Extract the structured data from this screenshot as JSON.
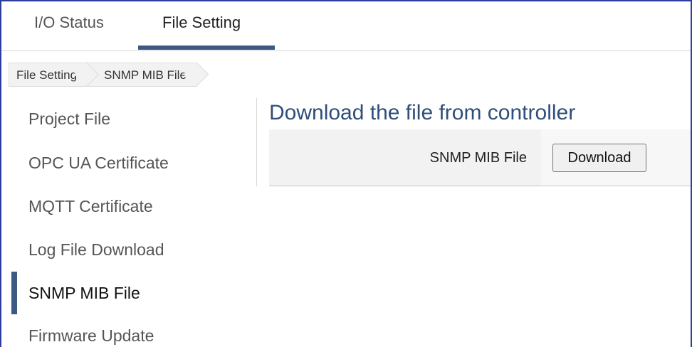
{
  "tabs": [
    {
      "label": "I/O Status",
      "active": false
    },
    {
      "label": "File Setting",
      "active": true
    }
  ],
  "breadcrumb": [
    "File Setting",
    "SNMP MIB File"
  ],
  "sidebar": {
    "items": [
      {
        "label": "Project File",
        "active": false
      },
      {
        "label": "OPC UA Certificate",
        "active": false
      },
      {
        "label": "MQTT Certificate",
        "active": false
      },
      {
        "label": "Log File Download",
        "active": false
      },
      {
        "label": "SNMP MIB File",
        "active": true
      },
      {
        "label": "Firmware Update",
        "active": false
      }
    ]
  },
  "main": {
    "title": "Download the file from controller",
    "row_label": "SNMP MIB File",
    "download_label": "Download"
  },
  "colors": {
    "accent": "#3a5a85",
    "title": "#2e4f7a",
    "frame": "#2e3d99"
  }
}
